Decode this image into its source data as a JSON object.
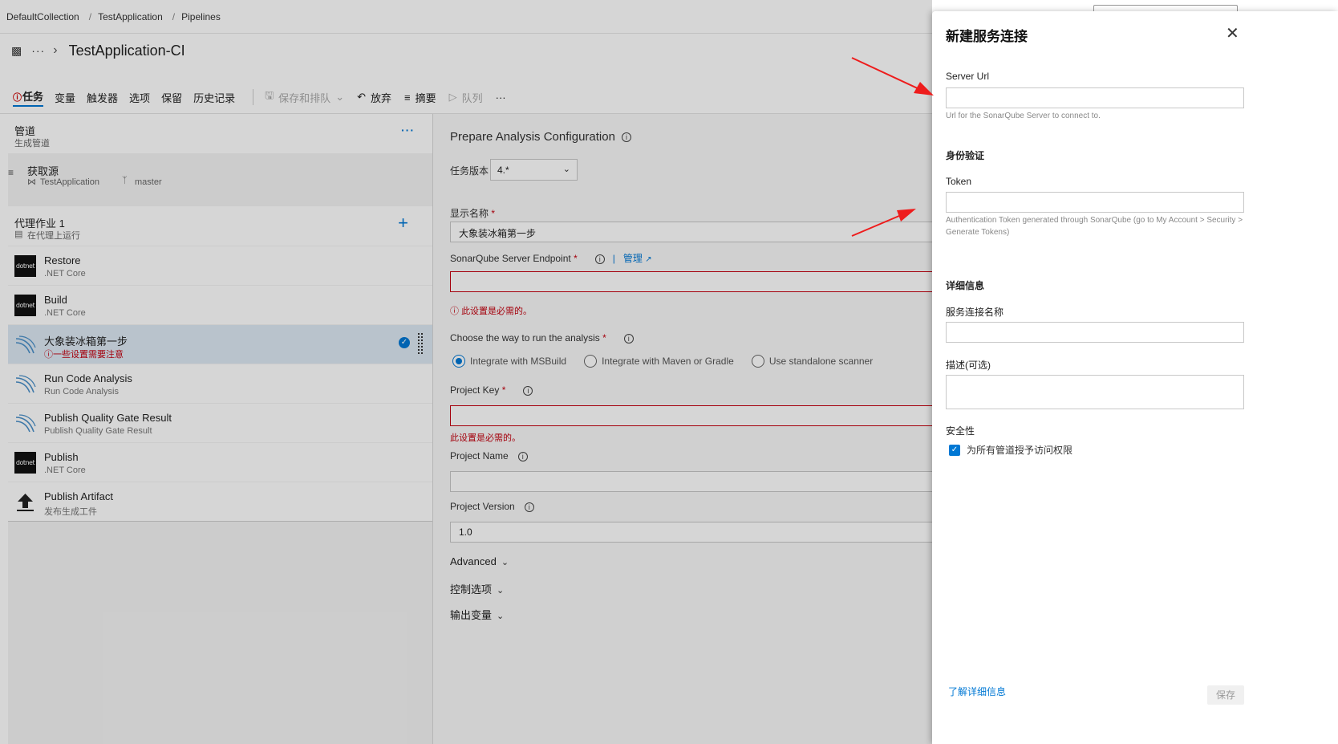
{
  "breadcrumb": [
    "DefaultCollection",
    "TestApplication",
    "Pipelines"
  ],
  "pipeline": {
    "title": "TestApplication-CI"
  },
  "toolbar": {
    "tabs": [
      "任务",
      "变量",
      "触发器",
      "选项",
      "保留",
      "历史记录"
    ],
    "save_queue": "保存和排队",
    "discard": "放弃",
    "summary": "摘要",
    "queue": "队列",
    "more": "···"
  },
  "left": {
    "pipeline_section": {
      "title": "管道",
      "subtitle": "生成管道"
    },
    "get_sources": {
      "title": "获取源",
      "repo": "TestApplication",
      "branch": "master"
    },
    "agent_job": {
      "title": "代理作业 1",
      "subtitle": "在代理上运行"
    },
    "tasks": [
      {
        "name": "Restore",
        "sub": ".NET Core",
        "icon": "dotnet-icon"
      },
      {
        "name": "Build",
        "sub": ".NET Core",
        "icon": "dotnet-icon"
      },
      {
        "name": "大象装冰箱第一步",
        "sub": "一些设置需要注意",
        "icon": "sonarqube-icon"
      },
      {
        "name": "Run Code Analysis",
        "sub": "Run Code Analysis",
        "icon": "sonarqube-icon"
      },
      {
        "name": "Publish Quality Gate Result",
        "sub": "Publish Quality Gate Result",
        "icon": "sonarqube-icon"
      },
      {
        "name": "Publish",
        "sub": ".NET Core",
        "icon": "dotnet-icon"
      },
      {
        "name": "Publish Artifact",
        "sub": "发布生成工件",
        "icon": "upload-icon"
      }
    ],
    "dotnet_label": "dotnet"
  },
  "form": {
    "title": "Prepare Analysis Configuration",
    "task_version_label": "任务版本",
    "task_version_value": "4.*",
    "display_name_label": "显示名称",
    "display_name_value": "大象装冰箱第一步",
    "endpoint_label": "SonarQube Server Endpoint",
    "manage_label": "管理",
    "required_error": "此设置是必需的。",
    "run_mode_label": "Choose the way to run the analysis",
    "run_modes": [
      "Integrate with MSBuild",
      "Integrate with Maven or Gradle",
      "Use standalone scanner"
    ],
    "selected_run_mode": "Integrate with MSBuild",
    "project_key_label": "Project Key",
    "project_name_label": "Project Name",
    "project_version_label": "Project Version",
    "project_version_value": "1.0",
    "advanced_label": "Advanced",
    "control_options_label": "控制选项",
    "output_vars_label": "输出变量"
  },
  "dialog": {
    "title": "新建服务连接",
    "server_url_label": "Server Url",
    "server_url_help": "Url for the SonarQube Server to connect to.",
    "auth_section": "身份验证",
    "token_label": "Token",
    "token_help": "Authentication Token generated through SonarQube (go to My Account > Security > Generate Tokens)",
    "details_section": "详细信息",
    "conn_name_label": "服务连接名称",
    "desc_label": "描述(可选)",
    "security_section": "安全性",
    "grant_access_label": "为所有管道授予访问权限",
    "grant_access_checked": true,
    "learn_more": "了解详细信息",
    "save_label": "保存"
  },
  "colors": {
    "accent": "#0078d4",
    "error": "#c4000f",
    "arrow": "#ee1c1c"
  }
}
